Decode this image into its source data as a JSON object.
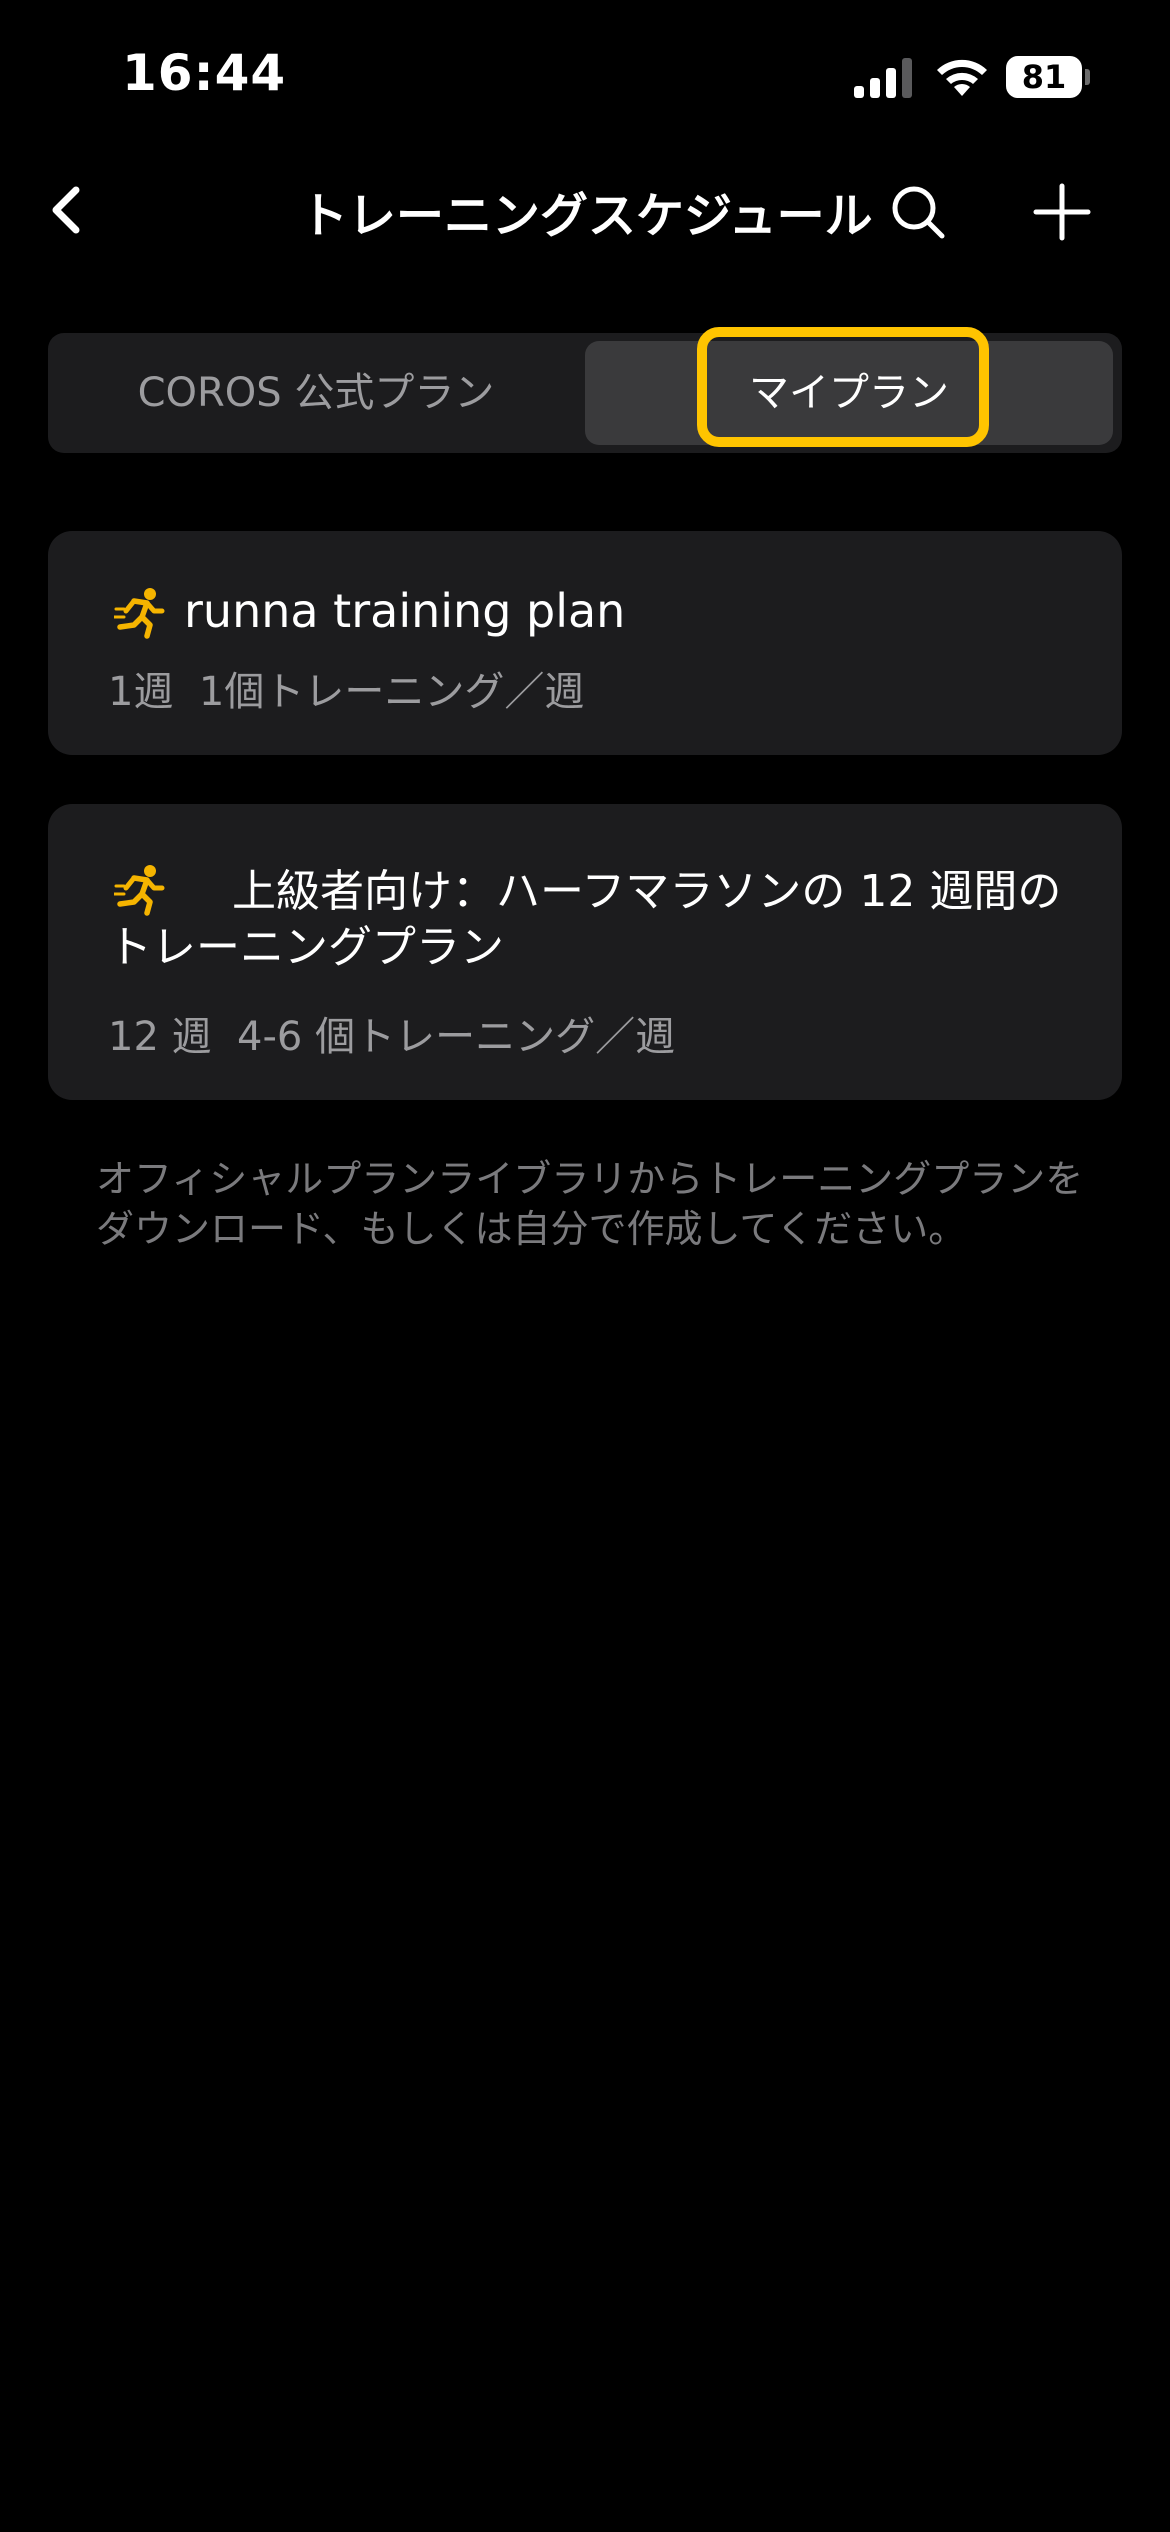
{
  "status_bar": {
    "time": "16:44",
    "battery": "81"
  },
  "nav": {
    "title": "トレーニングスケジュール",
    "back_icon": "chevron-left-icon",
    "search_icon": "search-icon",
    "add_icon": "plus-icon"
  },
  "tabs": {
    "left_label": "COROS 公式プラン",
    "right_label": "マイプラン",
    "selected": "マイプラン"
  },
  "plans": [
    {
      "icon": "runner-icon",
      "title": "runna training plan",
      "meta": "1週  1個トレーニング／週"
    },
    {
      "icon": "runner-icon",
      "title": "上級者向け：ハーフマラソンの 12 週間のトレーニングプラン",
      "meta": "12 週  4-6 個トレーニング／週"
    }
  ],
  "info": "オフィシャルプランライブラリからトレーニングプランをダウンロード、もしくは自分で作成してください。",
  "colors": {
    "accent": "#ffc400",
    "background": "#000000",
    "card": "#1c1c1e",
    "secondary_text": "#9c9c9f"
  }
}
